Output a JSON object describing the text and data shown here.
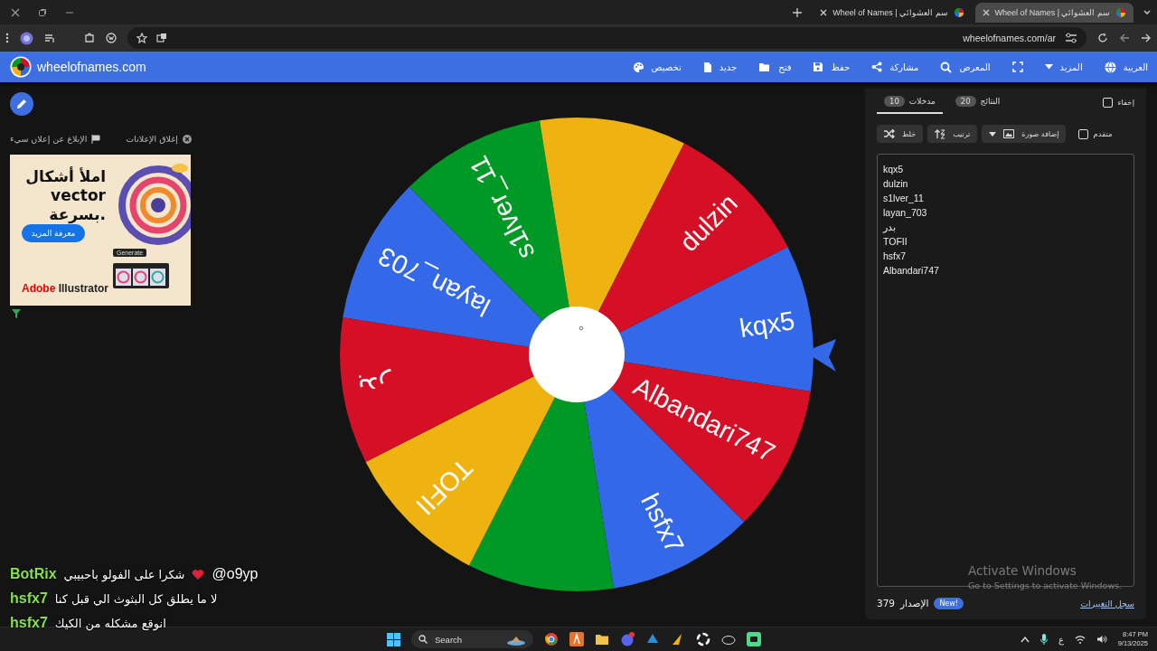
{
  "browser": {
    "tabs": [
      {
        "title": "Wheel of Names | سم العشوائي",
        "selected": true
      },
      {
        "title": "Wheel of Names | سم العشوائي",
        "selected": false
      }
    ],
    "address": "wheelofnames.com/ar"
  },
  "header": {
    "logo_text": "wheelofnames.com",
    "nav": [
      {
        "kind": "link",
        "label": "العربية"
      },
      {
        "kind": "menu",
        "label": "المزيد"
      },
      {
        "kind": "icon"
      },
      {
        "kind": "link",
        "label": "المعرض"
      },
      {
        "kind": "link",
        "label": "مشاركة"
      },
      {
        "kind": "link",
        "label": "حفظ"
      },
      {
        "kind": "link",
        "label": "فتح"
      },
      {
        "kind": "link",
        "label": "جديد"
      },
      {
        "kind": "link",
        "label": "تخصيص"
      }
    ]
  },
  "ad_links": [
    {
      "label": "إغلاق الإعلانات"
    },
    {
      "label": "الإبلاغ عن إعلان سيء"
    }
  ],
  "ad": {
    "headline": [
      "املأ أشكال",
      "vector",
      "بسرعة."
    ],
    "button": "معرفة المزيد",
    "chip": "Generate",
    "brand_a": "Adobe",
    "brand_b": "Illustrator"
  },
  "wheel": {
    "slices": [
      {
        "label": "kqx5",
        "color": "#3369e8"
      },
      {
        "label": "Albandari747",
        "color": "#d50f25"
      },
      {
        "label": "hsfx7",
        "color": "#3369e8"
      },
      {
        "color": "#009925"
      },
      {
        "label": "TOFII",
        "color": "#eeb211"
      },
      {
        "label": "بدر",
        "color": "#d50f25"
      },
      {
        "label": "layan_703",
        "color": "#3369e8"
      },
      {
        "label": "s1lver_11",
        "color": "#009925"
      },
      {
        "color": "#eeb211"
      },
      {
        "label": "dulzin",
        "color": "#d50f25"
      }
    ]
  },
  "panel": {
    "tabs": [
      {
        "label": "النتائج",
        "count": "20",
        "selected": false
      },
      {
        "label": "مدخلات",
        "count": "10",
        "selected": true
      }
    ],
    "hide": {
      "label": "إخفاء",
      "checked": false
    },
    "tools": [
      {
        "label": "إضافة صورة"
      },
      {
        "label": "ترتيب"
      },
      {
        "label": "خلط"
      }
    ],
    "advanced": {
      "label": "متقدم",
      "checked": false
    },
    "entries": [
      "kqx5",
      "dulzin",
      "s1lver_11",
      "layan_703",
      "بدر",
      "TOFII",
      "hsfx7",
      "Albandari747"
    ],
    "version": "379",
    "version_label": "الإصدار",
    "badge": "New!",
    "changelog": "سجل التغييرات"
  },
  "activation": {
    "title": "Activate Windows",
    "subtitle": "Go to Settings to activate Windows."
  },
  "chat": [
    {
      "kind": "reply",
      "user": "BotRix",
      "text": "شكرا على الفولو باحبيبي",
      "mention": "@o9yp"
    },
    {
      "kind": "message",
      "user": "hsfx7",
      "text": "لا ما يطلق كل البثوث الي قبل كنا"
    },
    {
      "kind": "message",
      "user": "hsfx7",
      "text": "انوقع مشكله من الكيك"
    }
  ],
  "taskbar": {
    "search": "Search",
    "input_language": "ع",
    "time": "8:47 PM",
    "date": "9/13/2025"
  }
}
